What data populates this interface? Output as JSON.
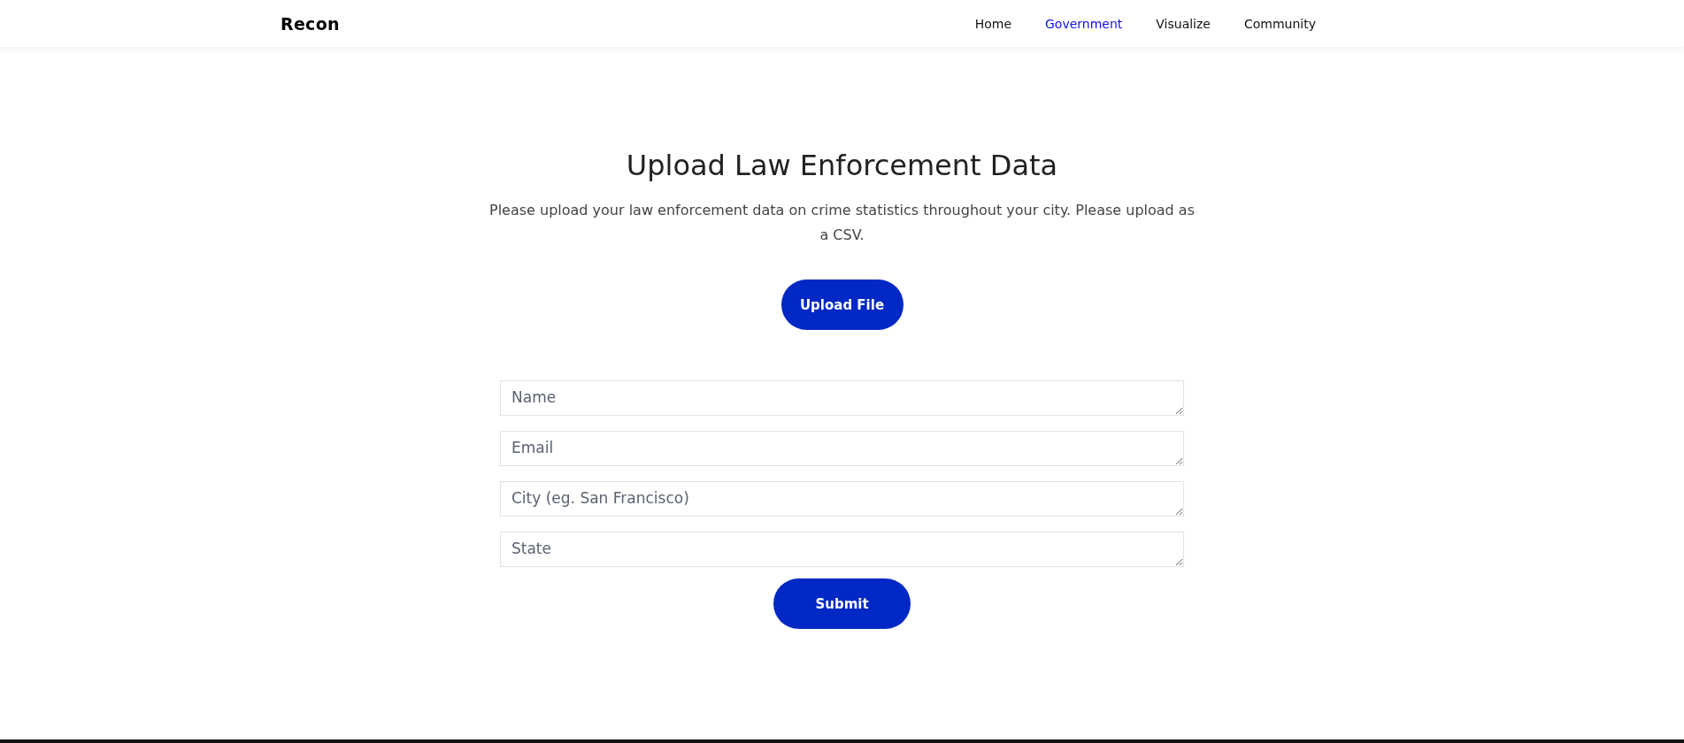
{
  "header": {
    "logo": "Recon",
    "nav": [
      {
        "label": "Home",
        "selected": false
      },
      {
        "label": "Government",
        "selected": true
      },
      {
        "label": "Visualize",
        "selected": false
      },
      {
        "label": "Community",
        "selected": false
      }
    ]
  },
  "main": {
    "title": "Upload Law Enforcement Data",
    "description": "Please upload your law enforcement data on crime statistics throughout your city. Please upload as a CSV.",
    "upload_button": "Upload File",
    "fields": [
      {
        "placeholder": "Name"
      },
      {
        "placeholder": "Email"
      },
      {
        "placeholder": "City (eg. San Francisco)"
      },
      {
        "placeholder": "State"
      }
    ],
    "submit_button": "Submit"
  }
}
